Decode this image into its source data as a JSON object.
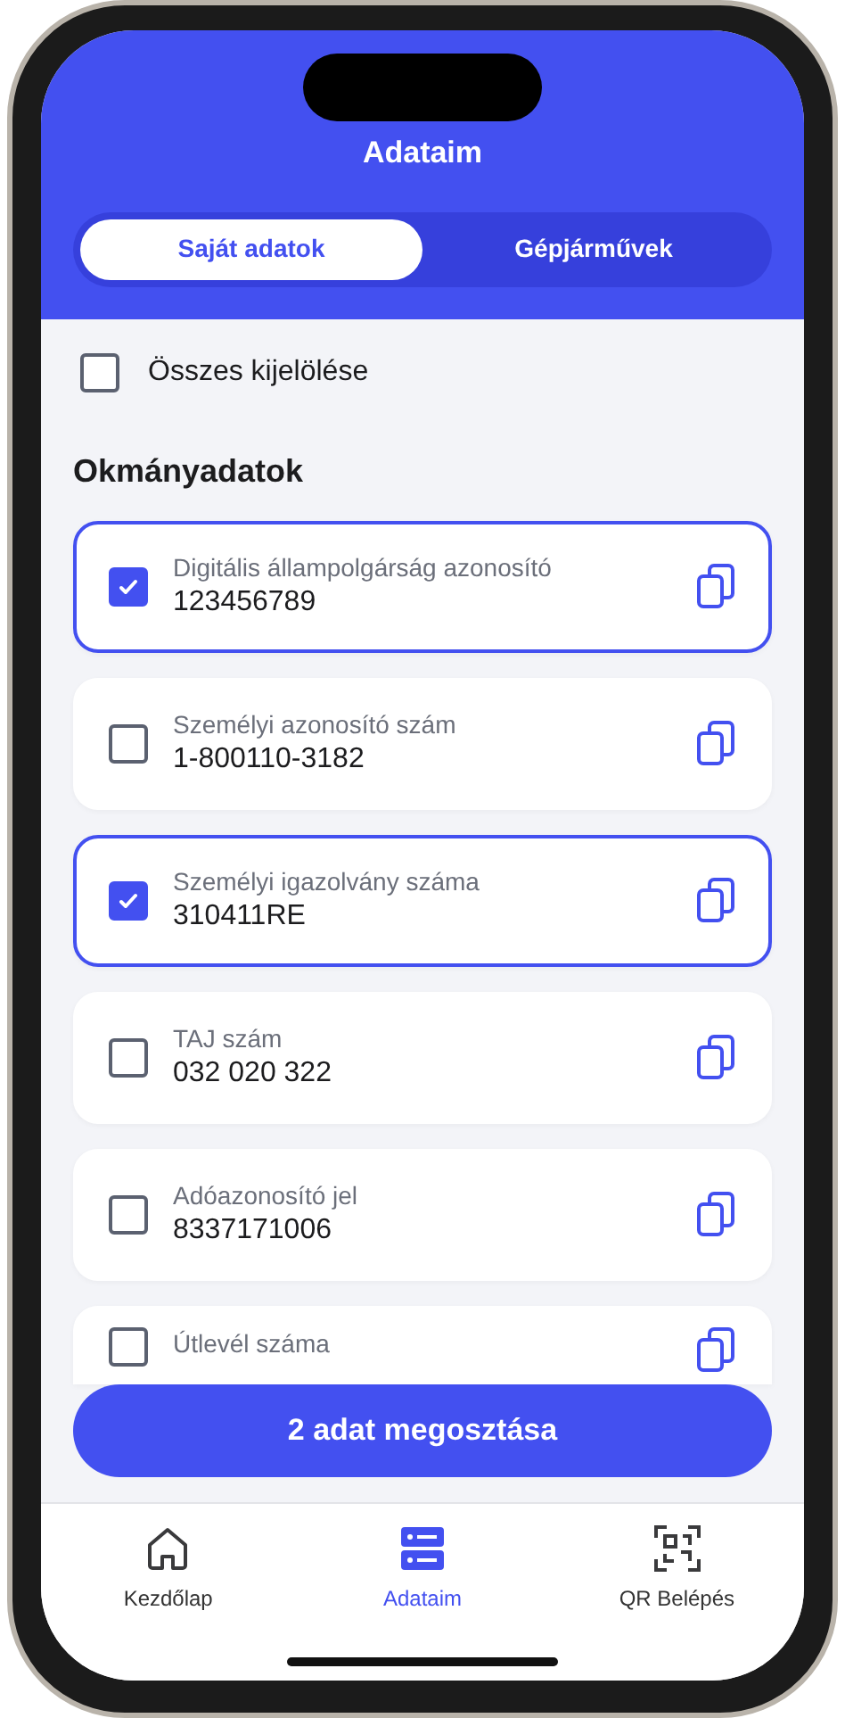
{
  "header": {
    "title": "Adataim"
  },
  "tabs": [
    {
      "label": "Saját adatok",
      "selected": true
    },
    {
      "label": "Gépjárművek",
      "selected": false
    }
  ],
  "select_all": {
    "label": "Összes kijelölése",
    "checked": false
  },
  "section_title": "Okmányadatok",
  "documents": [
    {
      "label": "Digitális állampolgárság azonosító",
      "value": "123456789",
      "checked": true
    },
    {
      "label": "Személyi azonosító szám",
      "value": "1-800110-3182",
      "checked": false
    },
    {
      "label": "Személyi igazolvány száma",
      "value": "310411RE",
      "checked": true
    },
    {
      "label": "TAJ szám",
      "value": "032 020 322",
      "checked": false
    },
    {
      "label": "Adóazonosító jel",
      "value": "8337171006",
      "checked": false
    },
    {
      "label": "Útlevél száma",
      "checked": false
    }
  ],
  "share_button": "2 adat megosztása",
  "bottom_nav": [
    {
      "kind": "home",
      "label": "Kezdőlap",
      "selected": false
    },
    {
      "kind": "data",
      "label": "Adataim",
      "selected": true
    },
    {
      "kind": "qr",
      "label": "QR Belépés",
      "selected": false
    }
  ]
}
